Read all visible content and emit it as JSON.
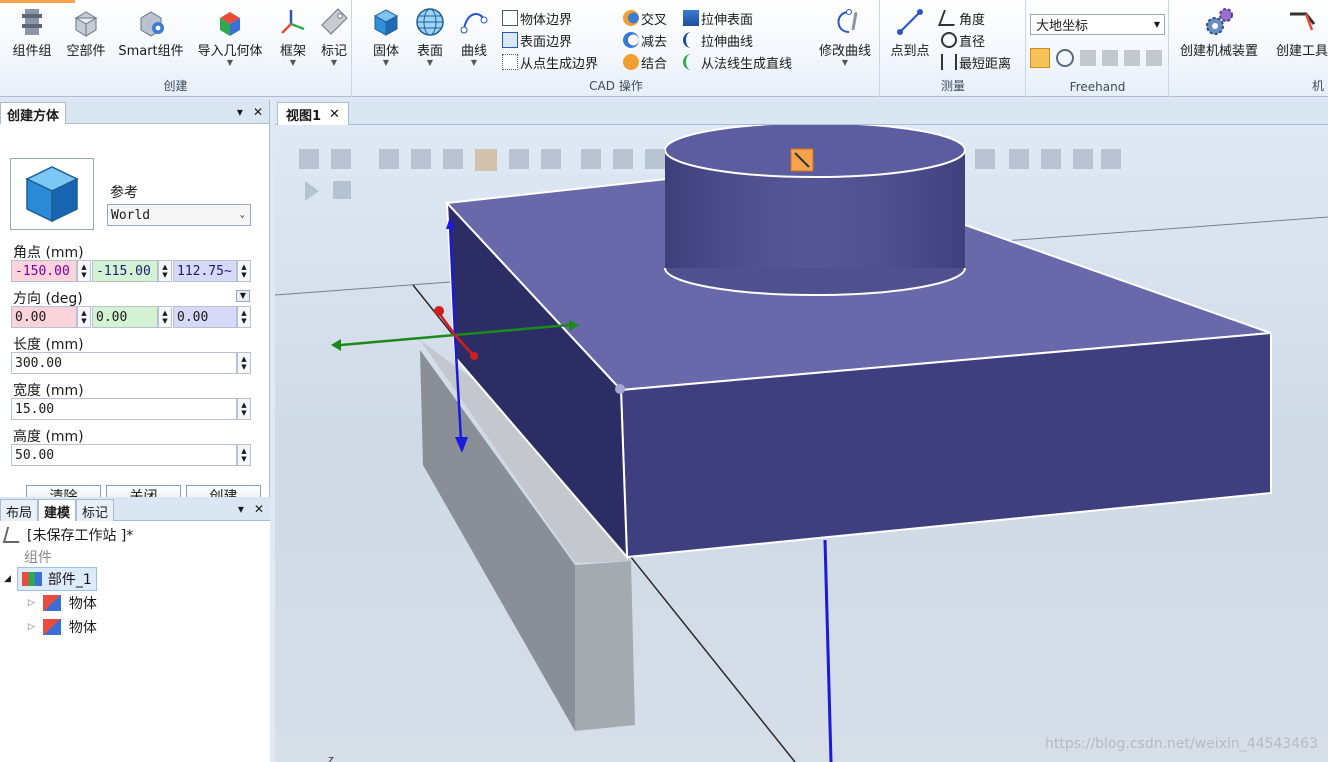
{
  "ribbon": {
    "create_group": {
      "label": "创建",
      "buttons": [
        {
          "label": "组件组",
          "icon": "component-group-icon"
        },
        {
          "label": "空部件",
          "icon": "empty-part-icon"
        },
        {
          "label": "Smart组件",
          "icon": "smart-component-icon"
        },
        {
          "label": "导入几何体",
          "icon": "import-geometry-icon"
        },
        {
          "label": "框架",
          "icon": "frame-icon"
        },
        {
          "label": "标记",
          "icon": "tag-icon"
        }
      ]
    },
    "cad_group": {
      "label": "CAD 操作",
      "big": [
        {
          "label": "固体",
          "icon": "solid-icon"
        },
        {
          "label": "表面",
          "icon": "surface-icon"
        },
        {
          "label": "曲线",
          "icon": "curve-icon"
        }
      ],
      "small_col1": [
        "物体边界",
        "表面边界",
        "从点生成边界"
      ],
      "small_col2": [
        "交叉",
        "减去",
        "结合"
      ],
      "small_col3": [
        "拉伸表面",
        "拉伸曲线",
        "从法线生成直线"
      ],
      "modify_curve": "修改曲线"
    },
    "measure_group": {
      "label": "测量",
      "point_to_point": "点到点",
      "items": [
        "角度",
        "直径",
        "最短距离"
      ]
    },
    "freehand_group": {
      "label": "Freehand",
      "coord_select": "大地坐标"
    },
    "mech_group": {
      "label": "机",
      "buttons": [
        "创建机械装置",
        "创建工具"
      ]
    }
  },
  "create_box": {
    "tab_label": "创建方体",
    "reference_label": "参考",
    "reference_value": "World",
    "corner_label": "角点 (mm)",
    "corner": [
      "-150.00",
      "-115.00",
      "112.75~"
    ],
    "direction_label": "方向 (deg)",
    "direction": [
      "0.00",
      "0.00",
      "0.00"
    ],
    "length_label": "长度 (mm)",
    "length": "300.00",
    "width_label": "宽度 (mm)",
    "width": "15.00",
    "height_label": "高度 (mm)",
    "height": "50.00",
    "clear_button": "清除",
    "close_button": "关闭",
    "create_button": "创建"
  },
  "tree": {
    "tabs": [
      "布局",
      "建模",
      "标记"
    ],
    "active_tab": "建模",
    "station": "[未保存工作站 ]*",
    "group_label": "组件",
    "part": "部件_1",
    "bodies": [
      "物体",
      "物体"
    ]
  },
  "viewport": {
    "tab_label": "视图1",
    "axis_label": "z",
    "watermark": "https://blog.csdn.net/weixin_44543463"
  },
  "colors": {
    "box_top": "#6868aa",
    "box_front": "#3f3f80",
    "box_left": "#2d2d66",
    "cylinder": "#50508f",
    "accent_orange": "#f6a24e",
    "preview_box": "#8a8e96"
  }
}
